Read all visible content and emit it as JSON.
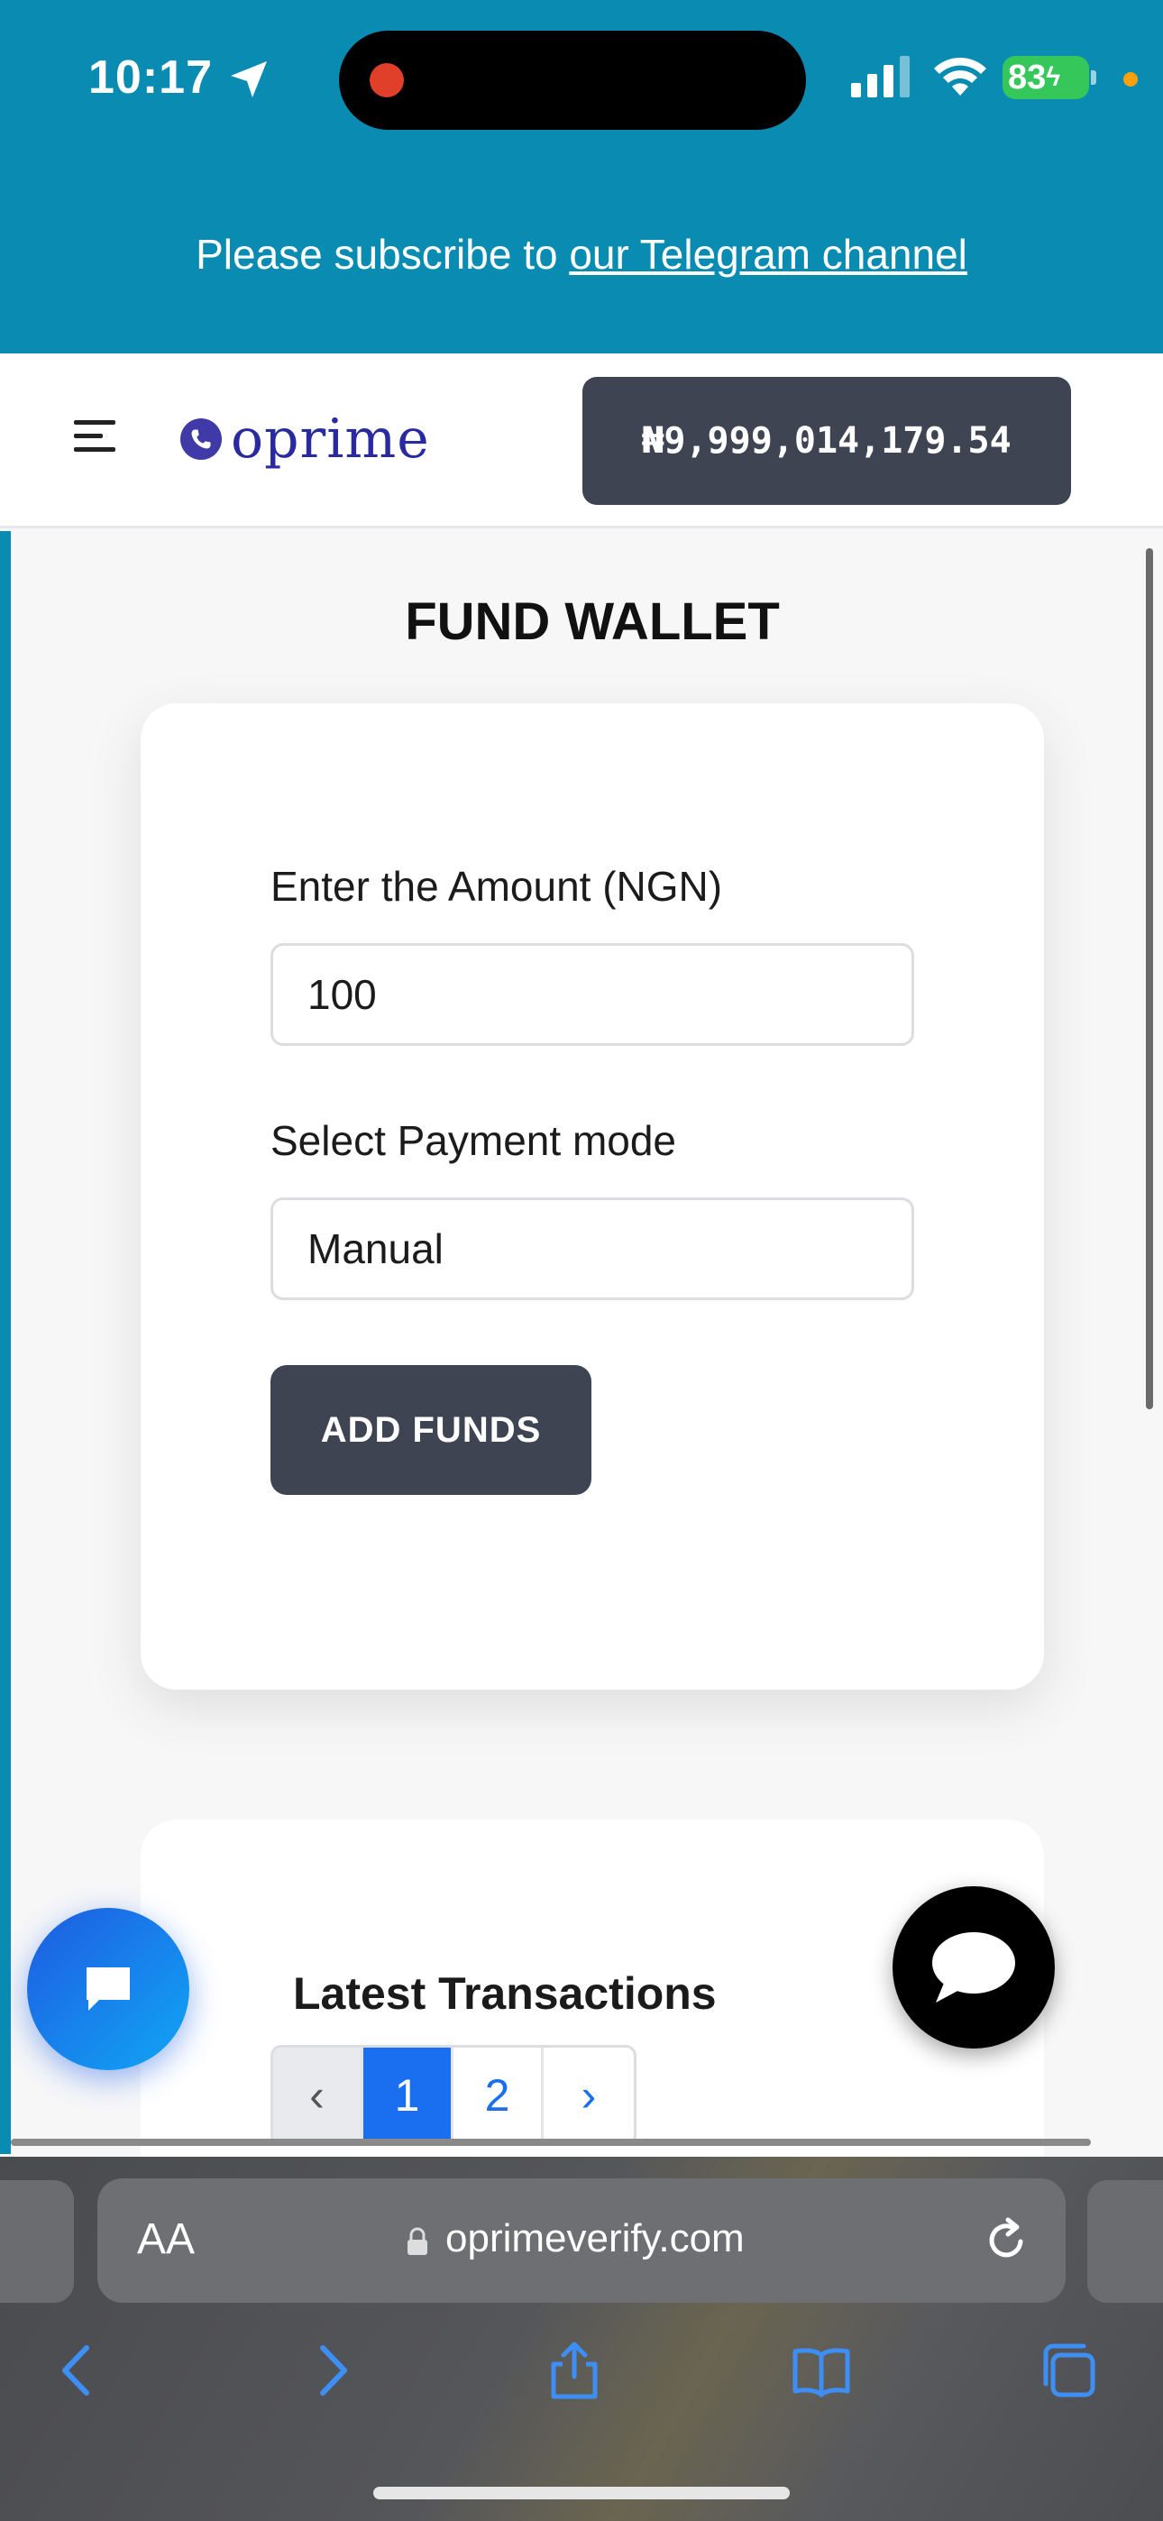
{
  "status_bar": {
    "time": "10:17",
    "battery": "83"
  },
  "banner": {
    "text": "Please subscribe to ",
    "link": "our Telegram channel"
  },
  "header": {
    "logo": "oprime",
    "balance": "₦9,999,014,179.54"
  },
  "main": {
    "title": "FUND WALLET",
    "amount_label": "Enter the Amount (NGN)",
    "amount_value": "100",
    "payment_label": "Select Payment mode",
    "payment_value": "Manual",
    "add_button": "ADD FUNDS"
  },
  "transactions": {
    "title": "Latest Transactions",
    "pager": {
      "prev": "‹",
      "pages": [
        "1",
        "2"
      ],
      "active": "1",
      "next": "›"
    }
  },
  "browser": {
    "aa": "AA",
    "url": "oprimeverify.com"
  },
  "colors": {
    "brand_teal": "#0a8cb2",
    "dark_button": "#3e4452",
    "pager_active": "#1a6ef0",
    "battery_green": "#35c759"
  }
}
